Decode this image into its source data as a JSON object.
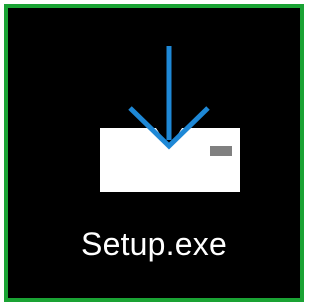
{
  "file": {
    "name": "Setup.exe",
    "icon": "install-drive-download-icon"
  },
  "colors": {
    "tile_background": "#000000",
    "selection_border": "#1aa334",
    "arrow": "#1e88d6",
    "drive_body": "#ffffff",
    "drive_light": "#808080",
    "label_text": "#ffffff"
  }
}
